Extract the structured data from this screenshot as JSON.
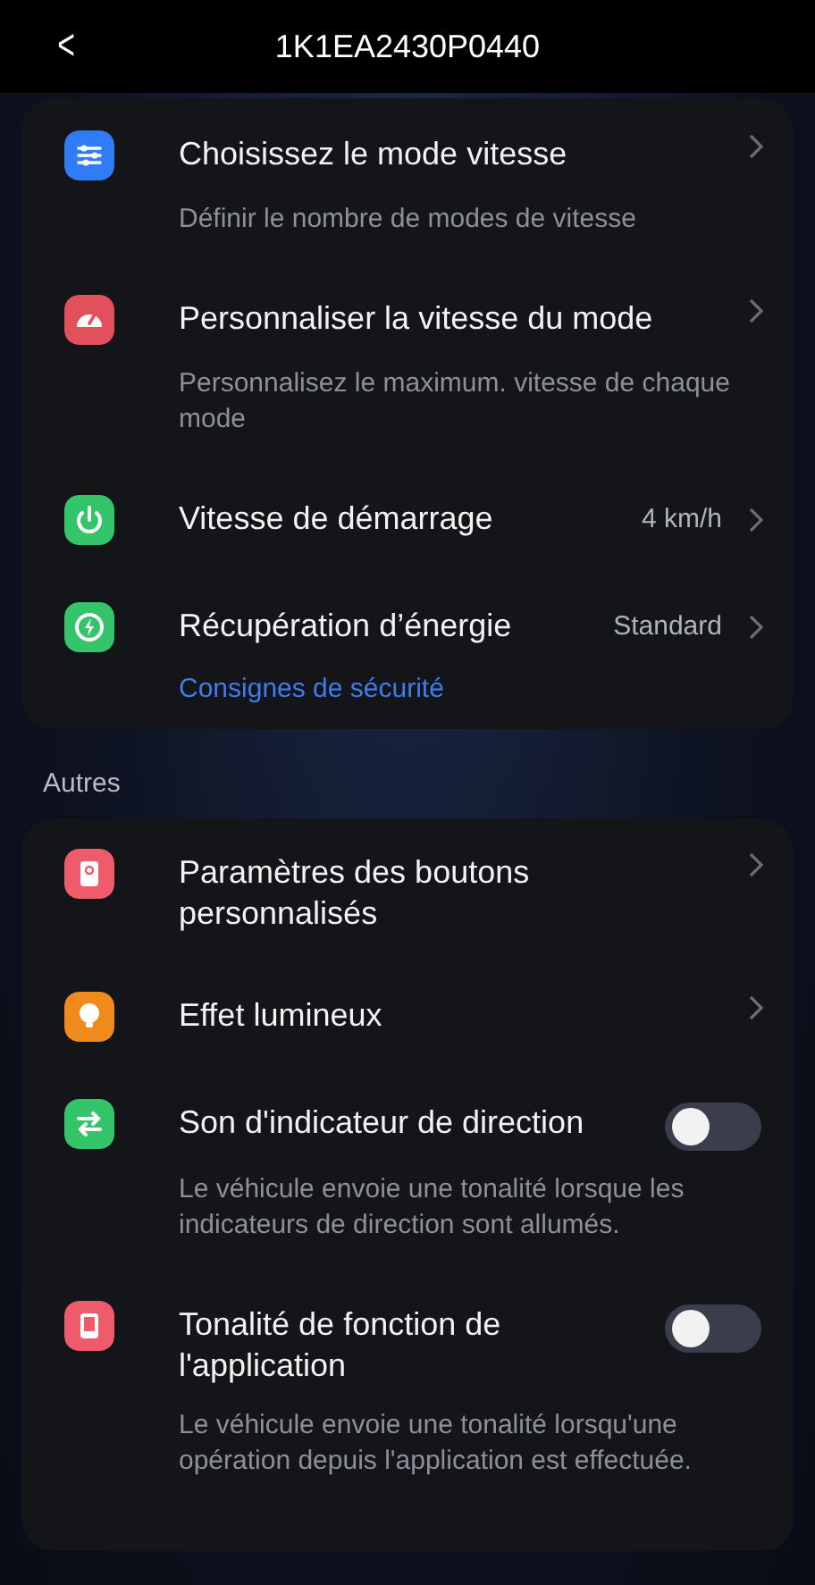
{
  "header": {
    "back": "<",
    "title": "1K1EA2430P0440"
  },
  "sections": [
    {
      "items": [
        {
          "kind": "nav",
          "color": "#2f7cf6",
          "title": "Choisissez le mode vitesse",
          "description": "Définir le nombre de modes de vitesse"
        },
        {
          "kind": "nav",
          "color": "#e2505c",
          "title": "Personnaliser la vitesse du mode",
          "description": "Personnalisez le maximum. vitesse de chaque mode"
        },
        {
          "kind": "nav",
          "color": "#34c56a",
          "title": "Vitesse de démarrage",
          "value": "4 km/h"
        },
        {
          "kind": "nav",
          "color": "#34c56a",
          "title": "Récupération d’énergie",
          "value": "Standard",
          "link": "Consignes de sécurité"
        }
      ]
    },
    {
      "heading": "Autres",
      "items": [
        {
          "kind": "nav",
          "color": "#ee5b6a",
          "title": "Paramètres des boutons personnalisés"
        },
        {
          "kind": "nav",
          "color": "#f08a1c",
          "title": "Effet lumineux"
        },
        {
          "kind": "toggle",
          "color": "#34c56a",
          "title": "Son d'indicateur de direction",
          "on": false,
          "description": "Le véhicule envoie une tonalité lorsque les indicateurs de direction sont allumés."
        },
        {
          "kind": "toggle",
          "color": "#ee5b6a",
          "title": "Tonalité de fonction de l'application",
          "on": false,
          "description": "Le véhicule envoie une tonalité lorsqu'une opération depuis l'application est effectuée."
        }
      ]
    }
  ]
}
